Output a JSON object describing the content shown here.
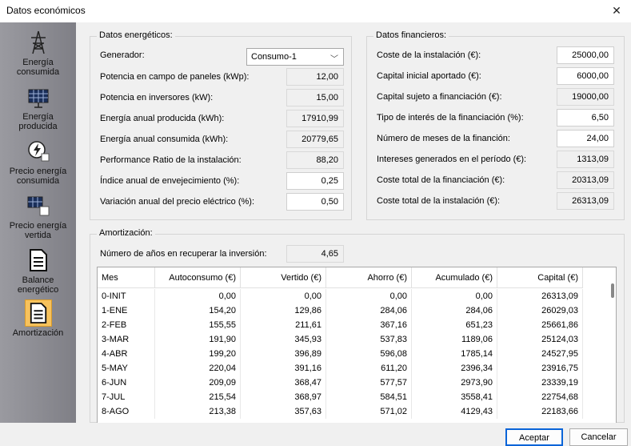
{
  "window": {
    "title": "Datos económicos"
  },
  "sidebar": {
    "items": [
      {
        "label1": "Energía",
        "label2": "consumida",
        "icon": "power-tower-icon"
      },
      {
        "label1": "Energía",
        "label2": "producida",
        "icon": "solar-panel-icon"
      },
      {
        "label1": "Precio energía",
        "label2": "consumida",
        "icon": "energy-price-icon"
      },
      {
        "label1": "Precio energía",
        "label2": "vertida",
        "icon": "solar-price-icon"
      },
      {
        "label1": "Balance",
        "label2": "energético",
        "icon": "document-icon"
      },
      {
        "label1": "Amortización",
        "label2": "",
        "icon": "document-icon"
      }
    ]
  },
  "energeticos": {
    "title": "Datos energéticos:",
    "generador_label": "Generador:",
    "generador_value": "Consumo-1",
    "rows": [
      {
        "label": "Potencia en campo de paneles (kWp):",
        "value": "12,00"
      },
      {
        "label": "Potencia en inversores (kW):",
        "value": "15,00"
      },
      {
        "label": "Energía anual producida (kWh):",
        "value": "17910,99"
      },
      {
        "label": "Energía anual consumida (kWh):",
        "value": "20779,65"
      },
      {
        "label": "Performance Ratio de la instalación:",
        "value": "88,20"
      },
      {
        "label": "Índice anual de envejecimiento (%):",
        "value": "0,25"
      },
      {
        "label": "Variación anual del precio eléctrico (%):",
        "value": "0,50"
      }
    ]
  },
  "financieros": {
    "title": "Datos financieros:",
    "rows": [
      {
        "label": "Coste de la instalación (€):",
        "value": "25000,00"
      },
      {
        "label": "Capital inicial aportado (€):",
        "value": "6000,00"
      },
      {
        "label": "Capital sujeto a financiación (€):",
        "value": "19000,00"
      },
      {
        "label": "Tipo de interés de la financiación (%):",
        "value": "6,50"
      },
      {
        "label": "Número de meses de la financión:",
        "value": "24,00"
      },
      {
        "label": "Intereses generados en el período (€):",
        "value": "1313,09"
      },
      {
        "label": "Coste total de la financiación (€):",
        "value": "20313,09"
      },
      {
        "label": "Coste total de la instalación (€):",
        "value": "26313,09"
      }
    ]
  },
  "amortizacion": {
    "title": "Amortización:",
    "anios_label": "Número de años en recuperar la inversión:",
    "anios_value": "4,65",
    "columns": [
      "Mes",
      "Autoconsumo (€)",
      "Vertido (€)",
      "Ahorro (€)",
      "Acumulado (€)",
      "Capital (€)"
    ],
    "rows": [
      [
        "0-INIT",
        "0,00",
        "0,00",
        "0,00",
        "0,00",
        "26313,09"
      ],
      [
        "1-ENE",
        "154,20",
        "129,86",
        "284,06",
        "284,06",
        "26029,03"
      ],
      [
        "2-FEB",
        "155,55",
        "211,61",
        "367,16",
        "651,23",
        "25661,86"
      ],
      [
        "3-MAR",
        "191,90",
        "345,93",
        "537,83",
        "1189,06",
        "25124,03"
      ],
      [
        "4-ABR",
        "199,20",
        "396,89",
        "596,08",
        "1785,14",
        "24527,95"
      ],
      [
        "5-MAY",
        "220,04",
        "391,16",
        "611,20",
        "2396,34",
        "23916,75"
      ],
      [
        "6-JUN",
        "209,09",
        "368,47",
        "577,57",
        "2973,90",
        "23339,19"
      ],
      [
        "7-JUL",
        "215,54",
        "368,97",
        "584,51",
        "3558,41",
        "22754,68"
      ],
      [
        "8-AGO",
        "213,38",
        "357,63",
        "571,02",
        "4129,43",
        "22183,66"
      ]
    ]
  },
  "buttons": {
    "accept": "Aceptar",
    "cancel": "Cancelar"
  }
}
